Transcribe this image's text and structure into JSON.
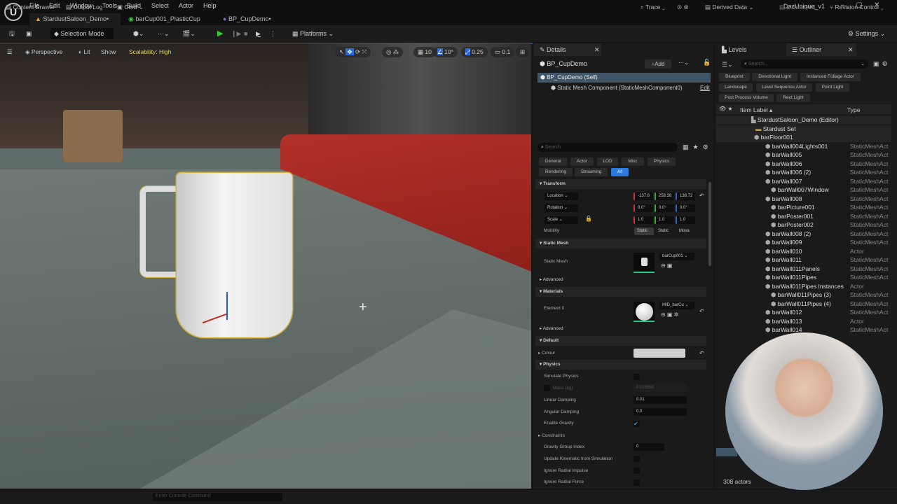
{
  "window": {
    "title": "DazUnique_v1",
    "menu": [
      "File",
      "Edit",
      "Window",
      "Tools",
      "Build",
      "Select",
      "Actor",
      "Help"
    ],
    "tabs": [
      "StardustSaloon_Demo•",
      "barCup001_PlasticCup",
      "BP_CupDemo•"
    ]
  },
  "toolbar": {
    "selection_mode": "Selection Mode",
    "platforms": "Platforms",
    "settings": "Settings"
  },
  "viewport": {
    "perspective": "Perspective",
    "lit": "Lit",
    "show": "Show",
    "scalability": "Scalability: High",
    "grid_snap": "10",
    "rot_snap": "10°",
    "scale_snap": "0.25",
    "camera_speed": "0.1"
  },
  "details": {
    "tab": "Details",
    "actor": "BP_CupDemo",
    "add": "Add",
    "self": "BP_CupDemo (Self)",
    "component": "Static Mesh Component (StaticMeshComponent0)",
    "edit": "Edit",
    "search_placeholder": "Search",
    "filters": [
      "General",
      "Actor",
      "LOD",
      "Misc",
      "Physics",
      "Rendering",
      "Streaming",
      "All"
    ],
    "transform": {
      "title": "Transform",
      "location": "Location",
      "rotation": "Rotation",
      "scale": "Scale",
      "loc": [
        "-137.6",
        "258.38",
        "138.72"
      ],
      "rot": [
        "0.0°",
        "0.0°",
        "0.0°"
      ],
      "scl": [
        "1.0",
        "1.0",
        "1.0"
      ],
      "mobility": "Mobility",
      "mob_opts": [
        "Static",
        "Static",
        "Mova"
      ]
    },
    "static_mesh": {
      "title": "Static Mesh",
      "label": "Static Mesh",
      "value": "barCup001",
      "advanced": "Advanced"
    },
    "materials": {
      "title": "Materials",
      "label": "Element 0",
      "value": "MID_barCu",
      "advanced": "Advanced"
    },
    "default": {
      "title": "Default",
      "colour": "Colour"
    },
    "physics": {
      "title": "Physics",
      "simulate": "Simulate Physics",
      "mass": "Mass (kg)",
      "mass_val": "0.029858",
      "linear": "Linear Damping",
      "linear_val": "0.01",
      "angular": "Angular Damping",
      "angular_val": "0.0",
      "gravity": "Enable Gravity",
      "constraints": "Constraints",
      "gravity_group": "Gravity Group Index",
      "gravity_group_val": "0",
      "kinematic": "Update Kinematic from Simulation",
      "radial_impulse": "Ignore Radial Impulse",
      "radial_force": "Ignore Radial Force"
    }
  },
  "outliner": {
    "levels_tab": "Levels",
    "tab": "Outliner",
    "search_placeholder": "Search...",
    "filters": [
      "Blueprint",
      "Directional Light",
      "Instanced Foliage Actor",
      "Landscape",
      "Level Sequence Actor",
      "Point Light",
      "Post Process Volume",
      "Rect Light"
    ],
    "col_label": "Item Label ▴",
    "col_type": "Type",
    "items": [
      {
        "label": "StardustSaloon_Demo (Editor)",
        "type": ""
      },
      {
        "label": "Stardust Set",
        "type": ""
      },
      {
        "label": "barFloor001",
        "type": ""
      },
      {
        "label": "barWall004Lights001",
        "type": "StaticMeshAct"
      },
      {
        "label": "barWall005",
        "type": "StaticMeshAct"
      },
      {
        "label": "barWall006",
        "type": "StaticMeshAct"
      },
      {
        "label": "barWall006 (2)",
        "type": "StaticMeshAct"
      },
      {
        "label": "barWall007",
        "type": "StaticMeshAct"
      },
      {
        "label": "barWall007Window",
        "type": "StaticMeshAct"
      },
      {
        "label": "barWall008",
        "type": "StaticMeshAct"
      },
      {
        "label": "barPicture001",
        "type": "StaticMeshAct"
      },
      {
        "label": "barPoster001",
        "type": "StaticMeshAct"
      },
      {
        "label": "barPoster002",
        "type": "StaticMeshAct"
      },
      {
        "label": "barWall008 (2)",
        "type": "StaticMeshAct"
      },
      {
        "label": "barWall009",
        "type": "StaticMeshAct"
      },
      {
        "label": "barWall010",
        "type": "Actor"
      },
      {
        "label": "barWall011",
        "type": "StaticMeshAct"
      },
      {
        "label": "barWall011Panels",
        "type": "StaticMeshAct"
      },
      {
        "label": "barWall011Pipes",
        "type": "StaticMeshAct"
      },
      {
        "label": "barWall011Pipes Instances",
        "type": "Actor"
      },
      {
        "label": "barWall011Pipes (3)",
        "type": "StaticMeshAct"
      },
      {
        "label": "barWall011Pipes (4)",
        "type": "StaticMeshAct"
      },
      {
        "label": "barWall012",
        "type": "StaticMeshAct"
      },
      {
        "label": "barWall013",
        "type": "Actor"
      },
      {
        "label": "barWall014",
        "type": "StaticMeshAct"
      }
    ],
    "count": "308 actors"
  },
  "status": {
    "content_drawer": "Content Drawer",
    "output_log": "Output Log",
    "cmd": "Cmd",
    "console_placeholder": "Enter Console Command",
    "trace": "Trace",
    "derived_data": "Derived Data",
    "unsaved": "2 Unsaved",
    "revision_control": "Revision Control"
  }
}
